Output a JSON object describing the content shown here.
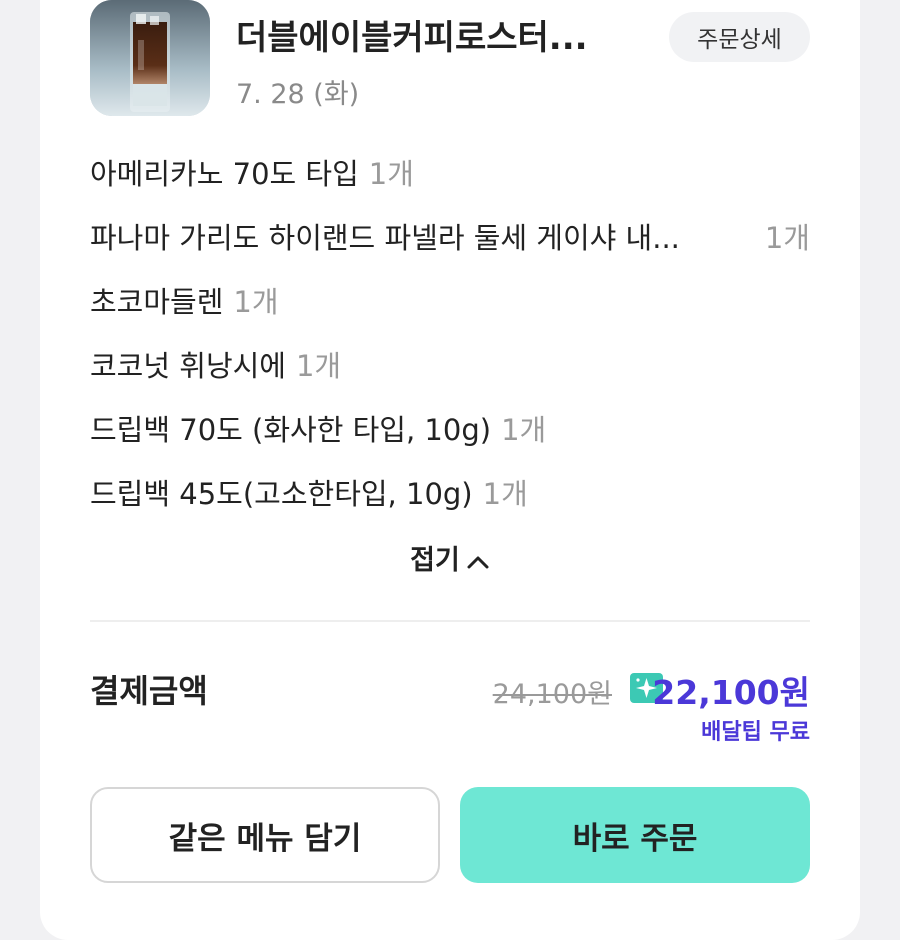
{
  "header": {
    "store_name": "더블에이블커피로스터...",
    "date": "7. 28 (화)",
    "detail_button": "주문상세"
  },
  "items": [
    {
      "name": "아메리카노 70도 타입",
      "qty": "1개"
    },
    {
      "name": "파나마 가리도 하이랜드 파넬라 둘세 게이샤 내...",
      "qty": "1개"
    },
    {
      "name": "초코마들렌",
      "qty": "1개"
    },
    {
      "name": "코코넛 휘낭시에",
      "qty": "1개"
    },
    {
      "name": "드립백 70도 (화사한 타입, 10g)",
      "qty": "1개"
    },
    {
      "name": "드립백 45도(고소한타입, 10g)",
      "qty": "1개"
    }
  ],
  "collapse_label": "접기",
  "payment": {
    "label": "결제금액",
    "original_price": "24,100원",
    "final_price": "22,100원",
    "delivery_tip": "배달팁 무료"
  },
  "buttons": {
    "same_menu": "같은 메뉴 담기",
    "order_now": "바로 주문"
  },
  "colors": {
    "accent_purple": "#4b38d8",
    "order_button_mint": "#6ee7d4",
    "badge_teal": "#3cc9b4"
  },
  "icons": {
    "collapse": "chevron-up-icon",
    "badge": "sparkle-star-icon"
  }
}
